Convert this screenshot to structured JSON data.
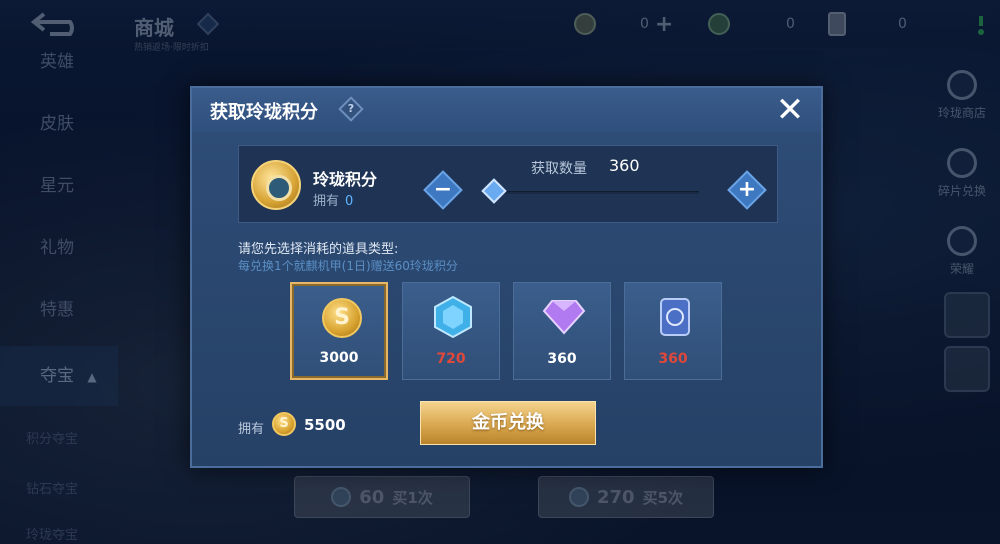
{
  "topbar": {
    "title": "商城",
    "subtitle": "热销返场·限时折扣",
    "currencies": [
      {
        "icon": "coupon-icon",
        "value": "0"
      },
      {
        "icon": "gem-icon",
        "value": "0"
      },
      {
        "icon": "card-icon",
        "value": "0"
      }
    ]
  },
  "left_nav": {
    "items": [
      "英雄",
      "皮肤",
      "星元",
      "礼物",
      "特惠",
      "夺宝"
    ],
    "active": "夺宝",
    "active_mark": "▲",
    "sub_items": [
      "积分夺宝",
      "钻石夺宝",
      "玲珑夺宝"
    ]
  },
  "right_nav": {
    "items": [
      "玲珑商店",
      "碎片兑换",
      "荣耀"
    ]
  },
  "bottom": {
    "buy1": {
      "price": "60",
      "label": "买1次"
    },
    "buy5": {
      "price": "270",
      "label": "买5次"
    }
  },
  "modal": {
    "title": "获取玲珑积分",
    "help": "?",
    "close": "✕",
    "point": {
      "name": "玲珑积分",
      "own_label": "拥有",
      "own_value": "0"
    },
    "quantity": {
      "label": "获取数量",
      "value": "360",
      "fraction": 0
    },
    "minus": "−",
    "plus": "+",
    "hint1": "请您先选择消耗的道具类型:",
    "hint2": "每兑换1个就麒机甲(1日)赠送60玲珑积分",
    "items": [
      {
        "icon": "gold-coin-icon",
        "value": "3000",
        "color": "#ffffff",
        "selected": true
      },
      {
        "icon": "blue-crystal-icon",
        "value": "720",
        "color": "#e0483a",
        "selected": false
      },
      {
        "icon": "purple-diamond-icon",
        "value": "360",
        "color": "#ffffff",
        "selected": false
      },
      {
        "icon": "card-coupon-icon",
        "value": "360",
        "color": "#e0483a",
        "selected": false
      }
    ],
    "owned": {
      "label": "拥有",
      "coin": "S",
      "value": "5500"
    },
    "exchange_label": "金币兑换"
  }
}
